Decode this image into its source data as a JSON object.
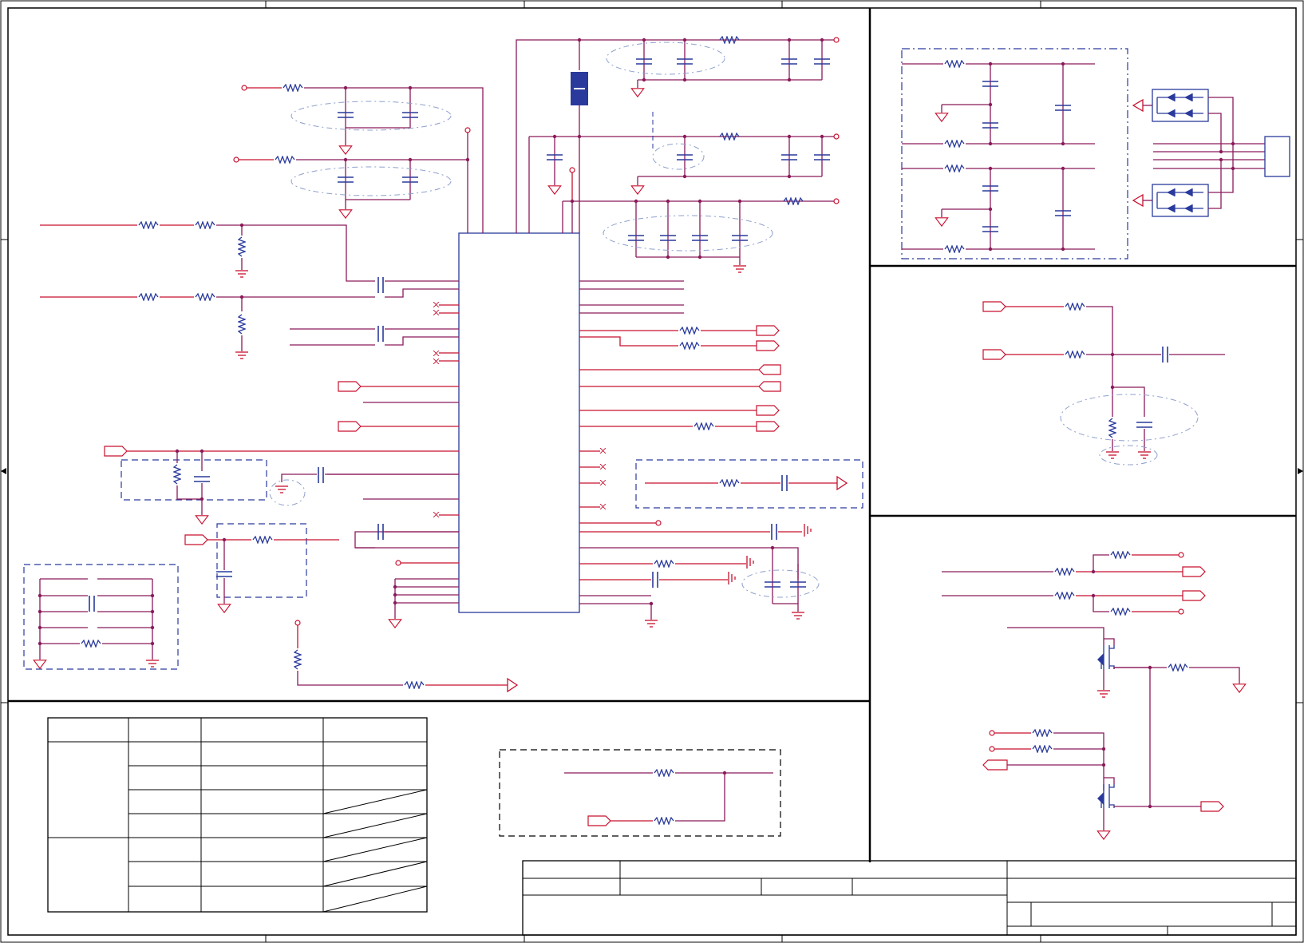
{
  "sheet": {
    "colors": {
      "wire": "#c8102e",
      "net": "#8b1a5a",
      "component": "#2a3a9c",
      "border": "#000000",
      "annotation": "#8fa0cc"
    },
    "symbols": [
      "ic",
      "resistor",
      "capacitor",
      "ground-symbol",
      "ferrite-bead",
      "tvs-diode-array",
      "mosfet",
      "connector",
      "port-flag",
      "no-connect-mark"
    ]
  }
}
